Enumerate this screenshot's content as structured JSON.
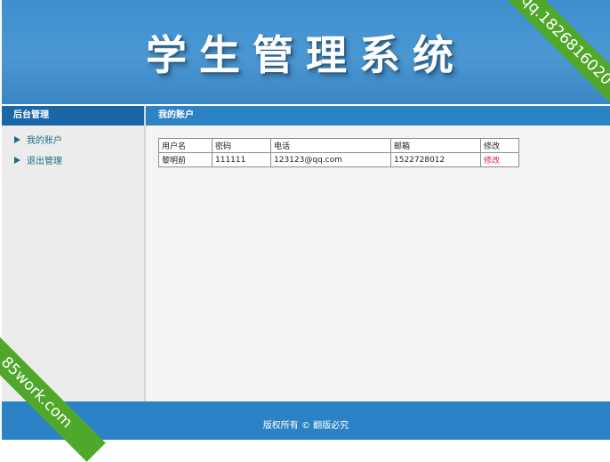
{
  "header": {
    "title": "学生管理系统"
  },
  "ribbons": {
    "top_right": "qq.1826816020",
    "bottom_left": "85work.com"
  },
  "sidebar": {
    "heading": "后台管理",
    "items": [
      {
        "label": "我的账户",
        "icon": "arrow-right-icon"
      },
      {
        "label": "退出管理",
        "icon": "arrow-right-icon"
      }
    ]
  },
  "main": {
    "heading": "我的账户",
    "table": {
      "columns": [
        "用户名",
        "密码",
        "电话",
        "邮箱",
        "修改"
      ],
      "rows": [
        {
          "username": "黎明前",
          "password": "111111",
          "phone": "123123@qq.com",
          "email": "1522728012",
          "edit": "修改"
        }
      ]
    }
  },
  "footer": {
    "copyright": "版权所有 © 翻版必究"
  },
  "colors": {
    "header_blue": "#3f8fcf",
    "nav_blue": "#1a67a8",
    "bar_blue": "#2b83c6",
    "ribbon_green": "#4fa82a",
    "link_red": "#c7254e"
  }
}
